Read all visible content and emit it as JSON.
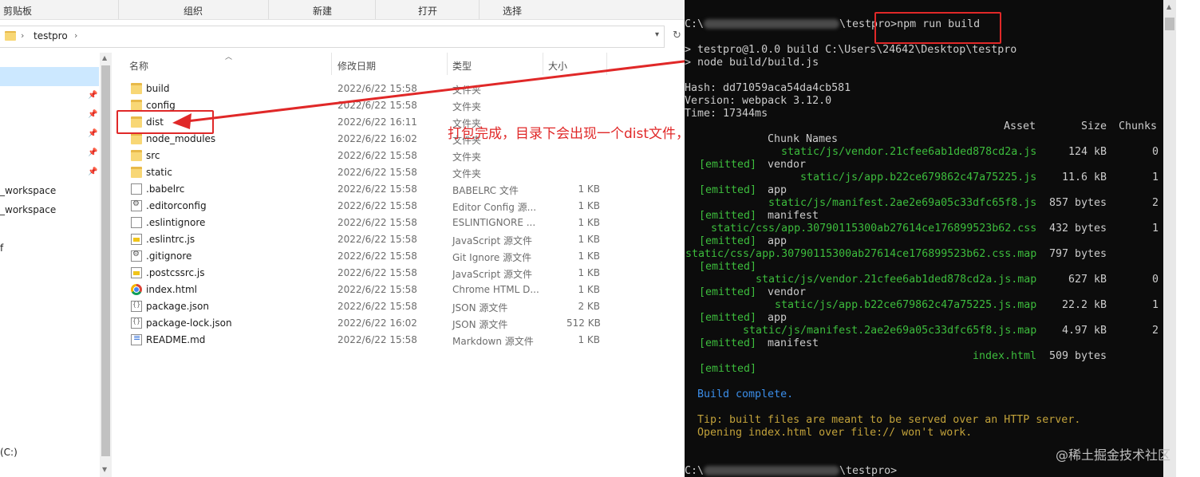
{
  "ribbon": {
    "clipboard": "剪贴板",
    "organize": "组织",
    "new": "新建",
    "open": "打开",
    "select": "选择"
  },
  "address": {
    "path": "testpro"
  },
  "nav": {
    "items": [
      "_workspace",
      "_workspace",
      "f"
    ],
    "drive": "(C:)"
  },
  "columns": {
    "name": "名称",
    "date": "修改日期",
    "type": "类型",
    "size": "大小"
  },
  "files": [
    {
      "icon": "folder",
      "name": "build",
      "date": "2022/6/22 15:58",
      "type": "文件夹",
      "size": ""
    },
    {
      "icon": "folder",
      "name": "config",
      "date": "2022/6/22 15:58",
      "type": "文件夹",
      "size": ""
    },
    {
      "icon": "folder",
      "name": "dist",
      "date": "2022/6/22 16:11",
      "type": "文件夹",
      "size": ""
    },
    {
      "icon": "folder",
      "name": "node_modules",
      "date": "2022/6/22 16:02",
      "type": "文件夹",
      "size": ""
    },
    {
      "icon": "folder",
      "name": "src",
      "date": "2022/6/22 15:58",
      "type": "文件夹",
      "size": ""
    },
    {
      "icon": "folder",
      "name": "static",
      "date": "2022/6/22 15:58",
      "type": "文件夹",
      "size": ""
    },
    {
      "icon": "file",
      "name": ".babelrc",
      "date": "2022/6/22 15:58",
      "type": "BABELRC 文件",
      "size": "1 KB"
    },
    {
      "icon": "cfg",
      "name": ".editorconfig",
      "date": "2022/6/22 15:58",
      "type": "Editor Config 源...",
      "size": "1 KB"
    },
    {
      "icon": "file",
      "name": ".eslintignore",
      "date": "2022/6/22 15:58",
      "type": "ESLINTIGNORE ...",
      "size": "1 KB"
    },
    {
      "icon": "js",
      "name": ".eslintrc.js",
      "date": "2022/6/22 15:58",
      "type": "JavaScript 源文件",
      "size": "1 KB"
    },
    {
      "icon": "cfg",
      "name": ".gitignore",
      "date": "2022/6/22 15:58",
      "type": "Git Ignore 源文件",
      "size": "1 KB"
    },
    {
      "icon": "js",
      "name": ".postcssrc.js",
      "date": "2022/6/22 15:58",
      "type": "JavaScript 源文件",
      "size": "1 KB"
    },
    {
      "icon": "chrome",
      "name": "index.html",
      "date": "2022/6/22 15:58",
      "type": "Chrome HTML D...",
      "size": "1 KB"
    },
    {
      "icon": "json",
      "name": "package.json",
      "date": "2022/6/22 15:58",
      "type": "JSON 源文件",
      "size": "2 KB"
    },
    {
      "icon": "json",
      "name": "package-lock.json",
      "date": "2022/6/22 16:02",
      "type": "JSON 源文件",
      "size": "512 KB"
    },
    {
      "icon": "md",
      "name": "README.md",
      "date": "2022/6/22 15:58",
      "type": "Markdown 源文件",
      "size": "1 KB"
    }
  ],
  "annotation": "打包完成，目录下会出现一个dist文件，用来放打包之后的内容",
  "terminal": {
    "prompt_prefix": "C:\\",
    "prompt_suffix": "\\testpro>",
    "command": "npm run build",
    "line_script1": "> testpro@1.0.0 build C:\\Users\\24642\\Desktop\\testpro",
    "line_script2": "> node build/build.js",
    "hash": "Hash: dd71059aca54da4cb581",
    "version": "Version: webpack 3.12.0",
    "time": "Time: 17344ms",
    "header_asset": "Asset",
    "header_size": "Size",
    "header_chunks": "Chunks",
    "header_chunknames": "Chunk Names",
    "emitted": "[emitted]",
    "assets": [
      {
        "file": "static/js/vendor.21cfee6ab1ded878cd2a.js",
        "size": "124 kB",
        "chunk": "0",
        "name": "vendor"
      },
      {
        "file": "static/js/app.b22ce679862c47a75225.js",
        "size": "11.6 kB",
        "chunk": "1",
        "name": "app"
      },
      {
        "file": "static/js/manifest.2ae2e69a05c33dfc65f8.js",
        "size": "857 bytes",
        "chunk": "2",
        "name": "manifest"
      },
      {
        "file": "static/css/app.30790115300ab27614ce176899523b62.css",
        "size": "432 bytes",
        "chunk": "1",
        "name": "app"
      },
      {
        "file": "static/css/app.30790115300ab27614ce176899523b62.css.map",
        "size": "797 bytes",
        "chunk": "",
        "name": ""
      },
      {
        "file": "static/js/vendor.21cfee6ab1ded878cd2a.js.map",
        "size": "627 kB",
        "chunk": "0",
        "name": "vendor"
      },
      {
        "file": "static/js/app.b22ce679862c47a75225.js.map",
        "size": "22.2 kB",
        "chunk": "1",
        "name": "app"
      },
      {
        "file": "static/js/manifest.2ae2e69a05c33dfc65f8.js.map",
        "size": "4.97 kB",
        "chunk": "2",
        "name": "manifest"
      },
      {
        "file": "index.html",
        "size": "509 bytes",
        "chunk": "",
        "name": ""
      }
    ],
    "build_complete": "Build complete.",
    "tip1": "Tip: built files are meant to be served over an HTTP server.",
    "tip2": "Opening index.html over file:// won't work."
  },
  "watermark": "@稀土掘金技术社区",
  "colors": {
    "annotation_red": "#e02828",
    "terminal_green": "#3dbd3d",
    "terminal_blue": "#3b8eea",
    "terminal_yellow": "#c2a23a"
  }
}
